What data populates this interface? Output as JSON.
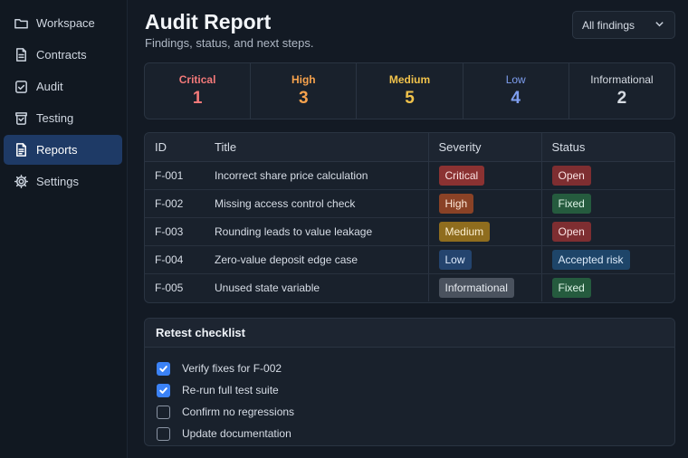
{
  "sidebar": {
    "items": [
      {
        "label": "Workspace",
        "icon": "folder-icon",
        "active": false
      },
      {
        "label": "Contracts",
        "icon": "document-icon",
        "active": false
      },
      {
        "label": "Audit",
        "icon": "audit-icon",
        "active": false
      },
      {
        "label": "Testing",
        "icon": "beaker-icon",
        "active": false
      },
      {
        "label": "Reports",
        "icon": "report-icon",
        "active": true
      },
      {
        "label": "Settings",
        "icon": "gear-icon",
        "active": false
      }
    ]
  },
  "header": {
    "title": "Audit Report",
    "subtitle": "Findings, status, and next steps."
  },
  "filter": {
    "selected": "All findings"
  },
  "summary": [
    {
      "label": "Critical",
      "count": "1",
      "color": "#f27979"
    },
    {
      "label": "High",
      "count": "3",
      "color": "#f6a24d"
    },
    {
      "label": "Medium",
      "count": "5",
      "color": "#f0c24b"
    },
    {
      "label": "Low",
      "count": "4",
      "color": "#7f9ff0"
    },
    {
      "label": "Informational",
      "count": "2",
      "color": "#d6dbe2"
    }
  ],
  "table": {
    "headers": {
      "id": "ID",
      "title": "Title",
      "severity": "Severity",
      "status": "Status"
    },
    "rows": [
      {
        "id": "F-001",
        "title": "Incorrect share price calculation",
        "severity": "Critical",
        "status": "Open"
      },
      {
        "id": "F-002",
        "title": "Missing access control check",
        "severity": "High",
        "status": "Fixed"
      },
      {
        "id": "F-003",
        "title": "Rounding leads to value leakage",
        "severity": "Medium",
        "status": "Open"
      },
      {
        "id": "F-004",
        "title": "Zero-value deposit edge case",
        "severity": "Low",
        "status": "Accepted risk"
      },
      {
        "id": "F-005",
        "title": "Unused state variable",
        "severity": "Informational",
        "status": "Fixed"
      }
    ]
  },
  "checklist": {
    "title": "Retest checklist",
    "items": [
      {
        "label": "Verify fixes for F-002",
        "checked": true
      },
      {
        "label": "Re-run full test suite",
        "checked": true
      },
      {
        "label": "Confirm no regressions",
        "checked": false
      },
      {
        "label": "Update documentation",
        "checked": false
      }
    ]
  }
}
